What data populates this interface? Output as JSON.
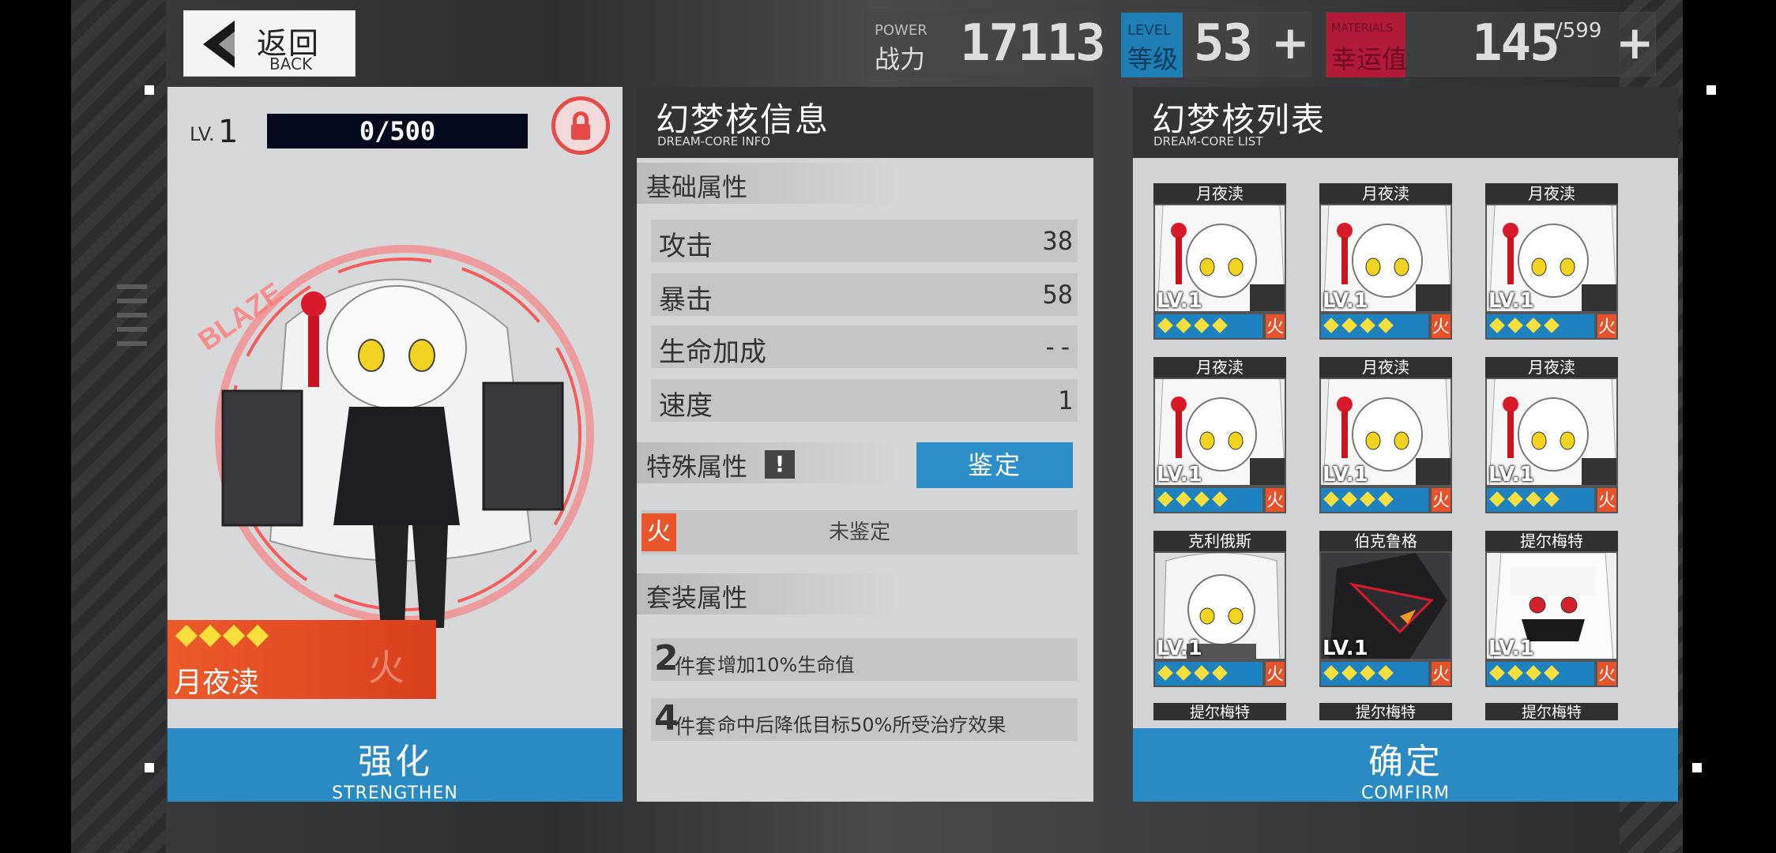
{
  "top_bar": {
    "back_zh": "返回",
    "back_en": "BACK",
    "power_en": "POWER",
    "power_zh": "战力",
    "power_value": "17113",
    "level_en": "LEVEL",
    "level_zh": "等级",
    "level_value": "53",
    "material_en": "MATERIALS",
    "material_zh": "幸运值",
    "material_value": "145",
    "material_max": "/599",
    "plus": "+"
  },
  "left": {
    "lv_label": "LV.",
    "lv_value": "1",
    "exp_text": "0/500",
    "exp_progress": 0,
    "gem_count": 4,
    "char_name": "月夜渎",
    "element": "火",
    "art_text": "BLAZE",
    "strengthen_zh": "强化",
    "strengthen_en": "STRENGTHEN"
  },
  "middle": {
    "title_zh": "幻梦核信息",
    "title_en": "DREAM-CORE INFO",
    "basic_title": "基础属性",
    "attributes": [
      {
        "name": "攻击",
        "value": "38"
      },
      {
        "name": "暴击",
        "value": "58"
      },
      {
        "name": "生命加成",
        "value": "--"
      },
      {
        "name": "速度",
        "value": "1"
      }
    ],
    "special_title": "特殊属性",
    "special_warn": "!",
    "appraise_label": "鉴定",
    "element_tag": "火",
    "element_status": "未鉴定",
    "set_title": "套装属性",
    "sets": [
      {
        "num": "2",
        "unit": "件套",
        "text": "增加10%生命值"
      },
      {
        "num": "4",
        "unit": "件套",
        "text": "命中后降低目标50%所受治疗效果"
      }
    ]
  },
  "right": {
    "title_zh": "幻梦核列表",
    "title_en": "DREAM-CORE LIST",
    "cards": [
      {
        "name": "月夜渎",
        "lv": "LV.1",
        "element": "火",
        "art": "white"
      },
      {
        "name": "月夜渎",
        "lv": "LV.1",
        "element": "火",
        "art": "white"
      },
      {
        "name": "月夜渎",
        "lv": "LV.1",
        "element": "火",
        "art": "white"
      },
      {
        "name": "月夜渎",
        "lv": "LV.1",
        "element": "火",
        "art": "white"
      },
      {
        "name": "月夜渎",
        "lv": "LV.1",
        "element": "火",
        "art": "white"
      },
      {
        "name": "月夜渎",
        "lv": "LV.1",
        "element": "火",
        "art": "white"
      },
      {
        "name": "克利俄斯",
        "lv": "LV.1",
        "element": "火",
        "art": "pale"
      },
      {
        "name": "伯克鲁格",
        "lv": "LV.1",
        "element": "火",
        "art": "dark"
      },
      {
        "name": "提尔梅特",
        "lv": "LV.1",
        "element": "火",
        "art": "mask"
      }
    ],
    "partial_names": [
      "提尔梅特",
      "提尔梅特",
      "提尔梅特"
    ],
    "confirm_zh": "确定",
    "confirm_en": "COMFIRM"
  },
  "colors": {
    "accent_blue": "#2a8ac4",
    "fire_orange": "#e6532a",
    "gem_yellow": "#f8df3c",
    "lock_red": "#e54a46"
  }
}
